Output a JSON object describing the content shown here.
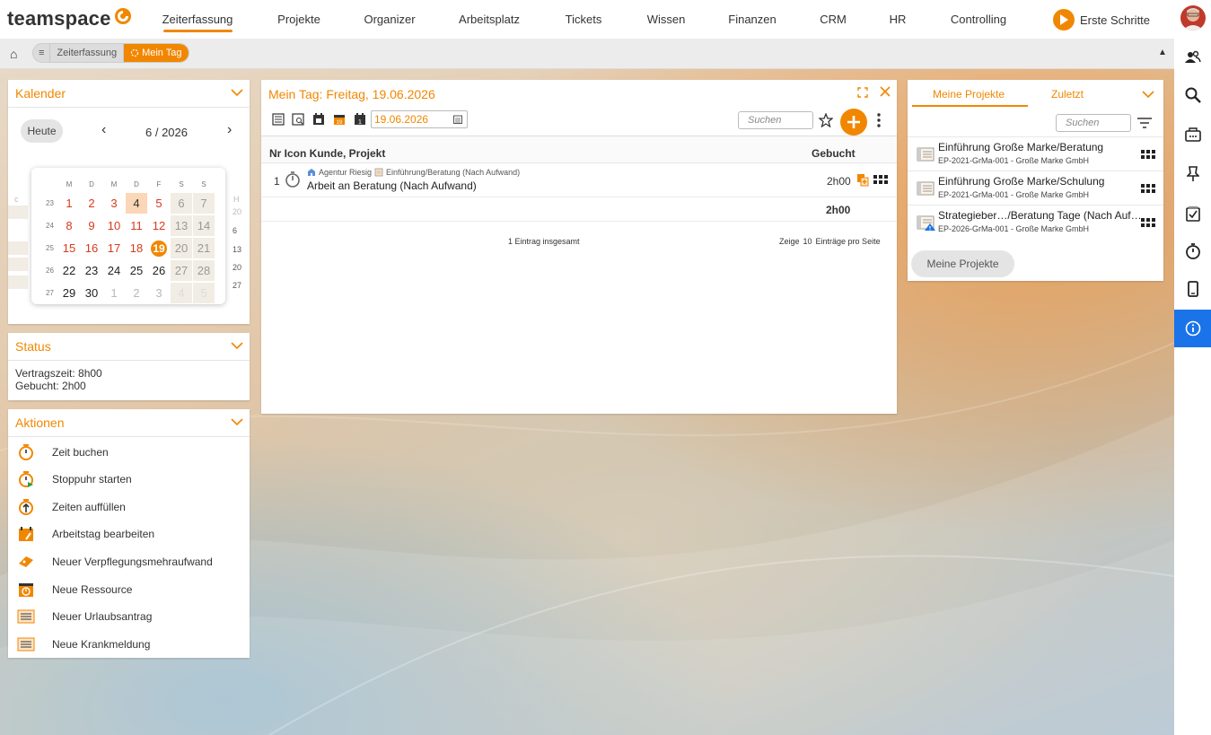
{
  "brand": {
    "name": "teamspace"
  },
  "nav": {
    "items": [
      "Zeiterfassung",
      "Projekte",
      "Organizer",
      "Arbeitsplatz",
      "Tickets",
      "Wissen",
      "Finanzen",
      "CRM",
      "HR",
      "Controlling"
    ],
    "active": "Zeiterfassung",
    "erste_schritte": "Erste Schritte"
  },
  "breadcrumb": {
    "menu": "≡",
    "items": [
      "Zeiterfassung",
      "Mein Tag"
    ]
  },
  "calendar": {
    "title": "Kalender",
    "today_button": "Heute",
    "month_label": "6 / 2026",
    "weekdays": [
      "M",
      "D",
      "M",
      "D",
      "F",
      "S",
      "S"
    ],
    "weeks": [
      {
        "kw": "23",
        "days": [
          "1",
          "2",
          "3",
          "4",
          "5",
          "6",
          "7"
        ]
      },
      {
        "kw": "24",
        "days": [
          "8",
          "9",
          "10",
          "11",
          "12",
          "13",
          "14"
        ]
      },
      {
        "kw": "25",
        "days": [
          "15",
          "16",
          "17",
          "18",
          "19",
          "20",
          "21"
        ]
      },
      {
        "kw": "26",
        "days": [
          "22",
          "23",
          "24",
          "25",
          "26",
          "27",
          "28"
        ]
      },
      {
        "kw": "27",
        "days": [
          "29",
          "30",
          "1",
          "2",
          "3",
          "4",
          "5"
        ]
      }
    ],
    "selected_day": "4",
    "today_day": "19"
  },
  "status": {
    "title": "Status",
    "vertragszeit": "Vertragszeit: 8h00",
    "gebucht": "Gebucht: 2h00"
  },
  "aktionen": {
    "title": "Aktionen",
    "items": [
      {
        "label": "Zeit buchen",
        "icon": "stopwatch-icon"
      },
      {
        "label": "Stoppuhr starten",
        "icon": "stopwatch-play-icon"
      },
      {
        "label": "Zeiten auffüllen",
        "icon": "stopwatch-up-icon"
      },
      {
        "label": "Arbeitstag bearbeiten",
        "icon": "calendar-edit-icon"
      },
      {
        "label": "Neuer Verpflegungsmehraufwand",
        "icon": "ticket-icon"
      },
      {
        "label": "Neue Ressource",
        "icon": "resource-icon"
      },
      {
        "label": "Neuer Urlaubsantrag",
        "icon": "form-icon"
      },
      {
        "label": "Neue Krankmeldung",
        "icon": "form-icon"
      }
    ]
  },
  "mein_tag": {
    "title": "Mein Tag: Freitag, 19.06.2026",
    "date_value": "19.06.2026",
    "search_placeholder": "Suchen",
    "columns": {
      "nr_icon_kunde_projekt": "Nr Icon Kunde, Projekt",
      "gebucht": "Gebucht"
    },
    "rows": [
      {
        "nr": "1",
        "customer": "Agentur Riesig",
        "project": "Einführung/Beratung (Nach Aufwand)",
        "activity": "Arbeit an Beratung (Nach Aufwand)",
        "booked": "2h00"
      }
    ],
    "total": "2h00",
    "summary": "1 Eintrag insgesamt",
    "paging": {
      "prefix": "Zeige",
      "count": "10",
      "suffix": "Einträge pro Seite"
    }
  },
  "projects": {
    "tabs": [
      "Meine Projekte",
      "Zuletzt"
    ],
    "search_placeholder": "Suchen",
    "items": [
      {
        "title": "Einführung Große Marke/Beratung",
        "sub": "EP-2021-GrMa-001 - Große Marke GmbH",
        "warning": false
      },
      {
        "title": "Einführung Große Marke/Schulung",
        "sub": "EP-2021-GrMa-001 - Große Marke GmbH",
        "warning": false
      },
      {
        "title": "Strategieber…/Beratung Tage (Nach Auf…",
        "sub": "EP-2026-GrMa-001 - Große Marke GmbH",
        "warning": true
      }
    ],
    "button": "Meine Projekte"
  },
  "colors": {
    "accent": "#f18700",
    "active_blue": "#1a73e8",
    "weekday_red": "#d9391a"
  }
}
